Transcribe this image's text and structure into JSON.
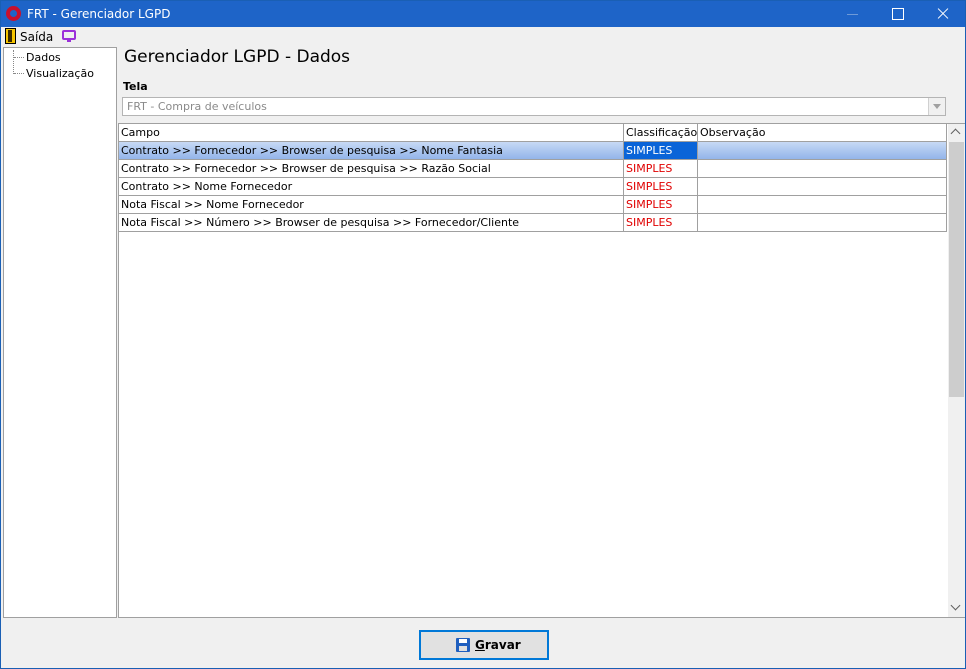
{
  "window": {
    "title": "FRT - Gerenciador LGPD"
  },
  "menu": {
    "exit_label": "Saída"
  },
  "tree": {
    "items": [
      {
        "label": "Dados"
      },
      {
        "label": "Visualização"
      }
    ]
  },
  "main": {
    "title": "Gerenciador LGPD - Dados",
    "tela_label": "Tela",
    "tela_value": "FRT - Compra de veículos"
  },
  "grid": {
    "columns": [
      "Campo",
      "Classificação",
      "Observação"
    ],
    "rows": [
      {
        "campo": "Contrato >> Fornecedor >> Browser de pesquisa >> Nome Fantasia",
        "classificacao": "SIMPLES",
        "observacao": "",
        "selected": true
      },
      {
        "campo": "Contrato >> Fornecedor >> Browser de pesquisa >> Razão Social",
        "classificacao": "SIMPLES",
        "observacao": ""
      },
      {
        "campo": "Contrato >> Nome Fornecedor",
        "classificacao": "SIMPLES",
        "observacao": ""
      },
      {
        "campo": "Nota Fiscal  >> Nome Fornecedor",
        "classificacao": "SIMPLES",
        "observacao": ""
      },
      {
        "campo": "Nota Fiscal >> Número  >> Browser de pesquisa >> Fornecedor/Cliente",
        "classificacao": "SIMPLES",
        "observacao": ""
      }
    ]
  },
  "footer": {
    "save_label": "Gravar"
  },
  "colors": {
    "titlebar": "#1e64c8",
    "selection": "#0a64d8",
    "classification_text": "#e00000",
    "accent_border": "#0078d7"
  },
  "icons": {
    "app": "app-logo-icon",
    "exit": "exit-door-icon",
    "monitor": "monitor-icon",
    "save": "floppy-disk-icon"
  }
}
